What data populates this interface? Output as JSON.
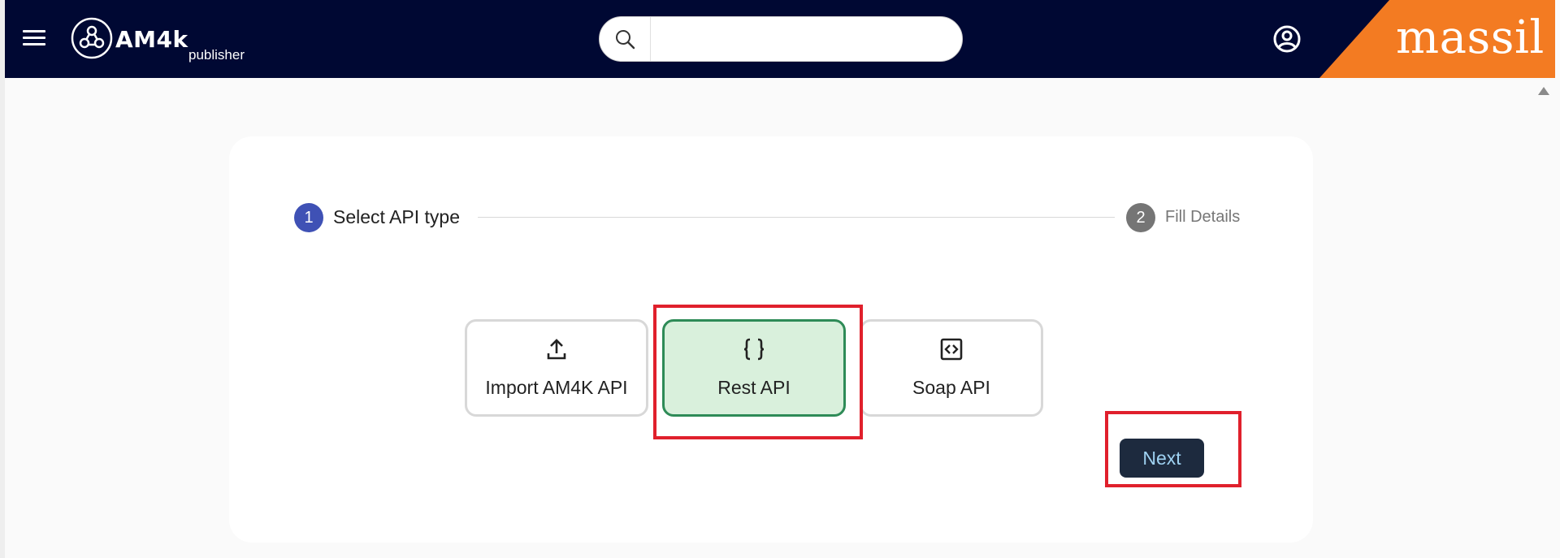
{
  "header": {
    "brand_name": "AM4k",
    "brand_sub": "publisher",
    "search_placeholder": "",
    "corner_brand": "massil",
    "colors": {
      "bar": "#000833",
      "corner": "#f37b22"
    }
  },
  "stepper": {
    "steps": [
      {
        "number": "1",
        "label": "Select API type",
        "state": "active"
      },
      {
        "number": "2",
        "label": "Fill Details",
        "state": "inactive"
      }
    ]
  },
  "api_types": [
    {
      "label": "Import AM4K API",
      "icon": "upload-icon",
      "selected": false
    },
    {
      "label": "Rest API",
      "icon": "curly-braces-icon",
      "selected": true
    },
    {
      "label": "Soap API",
      "icon": "code-brackets-icon",
      "selected": false
    }
  ],
  "actions": {
    "next_label": "Next"
  },
  "colors": {
    "selected_bg": "#d9f0dc",
    "selected_border": "#2e8b57",
    "highlight": "#e0202c",
    "step_active": "#3f51b5"
  }
}
